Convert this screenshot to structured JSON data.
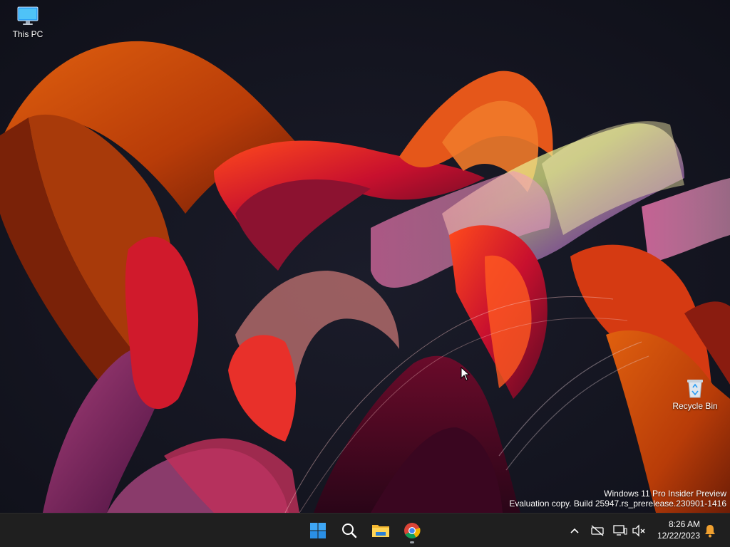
{
  "desktop": {
    "icons": [
      {
        "label": "This PC",
        "icon": "computer-monitor-icon"
      },
      {
        "label": "Recycle Bin",
        "icon": "recycle-bin-icon"
      }
    ],
    "watermark": {
      "line1": "Windows 11 Pro Insider Preview",
      "line2": "Evaluation copy. Build 25947.rs_prerelease.230901-1416"
    }
  },
  "taskbar": {
    "apps": [
      {
        "name": "Start",
        "icon": "windows-start-icon"
      },
      {
        "name": "Search",
        "icon": "search-icon"
      },
      {
        "name": "File Explorer",
        "icon": "file-explorer-icon"
      },
      {
        "name": "Google Chrome",
        "icon": "chrome-icon",
        "running": true
      }
    ],
    "tray": {
      "icons": [
        "chevron-up-icon",
        "network-disconnected-icon",
        "display-icon",
        "volume-muted-icon",
        "notification-bell-icon"
      ]
    },
    "clock": {
      "time": "8:26 AM",
      "date": "12/22/2023"
    }
  },
  "colors": {
    "taskbar_bg": "#1f1f1f",
    "desktop_bg": "#121420",
    "windows_blue": "#2a9df4",
    "notification_orange": "#f0a030"
  }
}
